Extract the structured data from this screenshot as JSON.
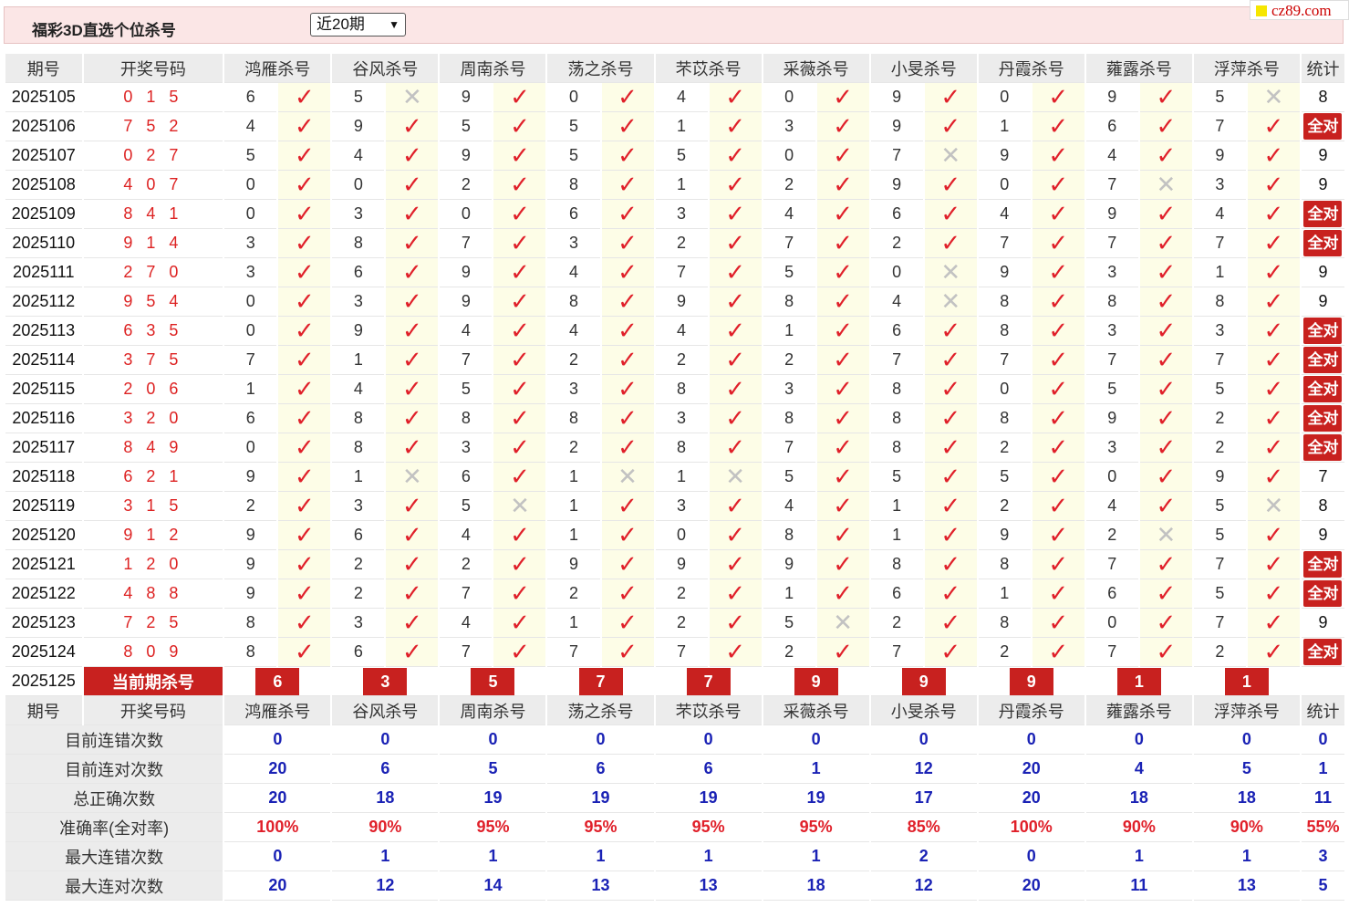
{
  "title": "福彩3D直选个位杀号",
  "period_select": "近20期",
  "brand": "cz89.com",
  "headers": {
    "issue": "期号",
    "draw": "开奖号码",
    "experts": [
      "鸿雁杀号",
      "谷风杀号",
      "周南杀号",
      "荡之杀号",
      "芣苡杀号",
      "采薇杀号",
      "小旻杀号",
      "丹霞杀号",
      "蕹露杀号",
      "浮萍杀号"
    ],
    "stat": "统计"
  },
  "rows": [
    {
      "issue": "2025105",
      "draw": "0 1 5",
      "kills": [
        [
          "6",
          1
        ],
        [
          "5",
          0
        ],
        [
          "9",
          1
        ],
        [
          "0",
          1
        ],
        [
          "4",
          1
        ],
        [
          "0",
          1
        ],
        [
          "9",
          1
        ],
        [
          "0",
          1
        ],
        [
          "9",
          1
        ],
        [
          "5",
          0
        ]
      ],
      "stat": "8"
    },
    {
      "issue": "2025106",
      "draw": "7 5 2",
      "kills": [
        [
          "4",
          1
        ],
        [
          "9",
          1
        ],
        [
          "5",
          1
        ],
        [
          "5",
          1
        ],
        [
          "1",
          1
        ],
        [
          "3",
          1
        ],
        [
          "9",
          1
        ],
        [
          "1",
          1
        ],
        [
          "6",
          1
        ],
        [
          "7",
          1
        ]
      ],
      "stat": "全对"
    },
    {
      "issue": "2025107",
      "draw": "0 2 7",
      "kills": [
        [
          "5",
          1
        ],
        [
          "4",
          1
        ],
        [
          "9",
          1
        ],
        [
          "5",
          1
        ],
        [
          "5",
          1
        ],
        [
          "0",
          1
        ],
        [
          "7",
          0
        ],
        [
          "9",
          1
        ],
        [
          "4",
          1
        ],
        [
          "9",
          1
        ]
      ],
      "stat": "9"
    },
    {
      "issue": "2025108",
      "draw": "4 0 7",
      "kills": [
        [
          "0",
          1
        ],
        [
          "0",
          1
        ],
        [
          "2",
          1
        ],
        [
          "8",
          1
        ],
        [
          "1",
          1
        ],
        [
          "2",
          1
        ],
        [
          "9",
          1
        ],
        [
          "0",
          1
        ],
        [
          "7",
          0
        ],
        [
          "3",
          1
        ]
      ],
      "stat": "9"
    },
    {
      "issue": "2025109",
      "draw": "8 4 1",
      "kills": [
        [
          "0",
          1
        ],
        [
          "3",
          1
        ],
        [
          "0",
          1
        ],
        [
          "6",
          1
        ],
        [
          "3",
          1
        ],
        [
          "4",
          1
        ],
        [
          "6",
          1
        ],
        [
          "4",
          1
        ],
        [
          "9",
          1
        ],
        [
          "4",
          1
        ]
      ],
      "stat": "全对"
    },
    {
      "issue": "2025110",
      "draw": "9 1 4",
      "kills": [
        [
          "3",
          1
        ],
        [
          "8",
          1
        ],
        [
          "7",
          1
        ],
        [
          "3",
          1
        ],
        [
          "2",
          1
        ],
        [
          "7",
          1
        ],
        [
          "2",
          1
        ],
        [
          "7",
          1
        ],
        [
          "7",
          1
        ],
        [
          "7",
          1
        ]
      ],
      "stat": "全对"
    },
    {
      "issue": "2025111",
      "draw": "2 7 0",
      "kills": [
        [
          "3",
          1
        ],
        [
          "6",
          1
        ],
        [
          "9",
          1
        ],
        [
          "4",
          1
        ],
        [
          "7",
          1
        ],
        [
          "5",
          1
        ],
        [
          "0",
          0
        ],
        [
          "9",
          1
        ],
        [
          "3",
          1
        ],
        [
          "1",
          1
        ]
      ],
      "stat": "9"
    },
    {
      "issue": "2025112",
      "draw": "9 5 4",
      "kills": [
        [
          "0",
          1
        ],
        [
          "3",
          1
        ],
        [
          "9",
          1
        ],
        [
          "8",
          1
        ],
        [
          "9",
          1
        ],
        [
          "8",
          1
        ],
        [
          "4",
          0
        ],
        [
          "8",
          1
        ],
        [
          "8",
          1
        ],
        [
          "8",
          1
        ]
      ],
      "stat": "9"
    },
    {
      "issue": "2025113",
      "draw": "6 3 5",
      "kills": [
        [
          "0",
          1
        ],
        [
          "9",
          1
        ],
        [
          "4",
          1
        ],
        [
          "4",
          1
        ],
        [
          "4",
          1
        ],
        [
          "1",
          1
        ],
        [
          "6",
          1
        ],
        [
          "8",
          1
        ],
        [
          "3",
          1
        ],
        [
          "3",
          1
        ]
      ],
      "stat": "全对"
    },
    {
      "issue": "2025114",
      "draw": "3 7 5",
      "kills": [
        [
          "7",
          1
        ],
        [
          "1",
          1
        ],
        [
          "7",
          1
        ],
        [
          "2",
          1
        ],
        [
          "2",
          1
        ],
        [
          "2",
          1
        ],
        [
          "7",
          1
        ],
        [
          "7",
          1
        ],
        [
          "7",
          1
        ],
        [
          "7",
          1
        ]
      ],
      "stat": "全对"
    },
    {
      "issue": "2025115",
      "draw": "2 0 6",
      "kills": [
        [
          "1",
          1
        ],
        [
          "4",
          1
        ],
        [
          "5",
          1
        ],
        [
          "3",
          1
        ],
        [
          "8",
          1
        ],
        [
          "3",
          1
        ],
        [
          "8",
          1
        ],
        [
          "0",
          1
        ],
        [
          "5",
          1
        ],
        [
          "5",
          1
        ]
      ],
      "stat": "全对"
    },
    {
      "issue": "2025116",
      "draw": "3 2 0",
      "kills": [
        [
          "6",
          1
        ],
        [
          "8",
          1
        ],
        [
          "8",
          1
        ],
        [
          "8",
          1
        ],
        [
          "3",
          1
        ],
        [
          "8",
          1
        ],
        [
          "8",
          1
        ],
        [
          "8",
          1
        ],
        [
          "9",
          1
        ],
        [
          "2",
          1
        ]
      ],
      "stat": "全对"
    },
    {
      "issue": "2025117",
      "draw": "8 4 9",
      "kills": [
        [
          "0",
          1
        ],
        [
          "8",
          1
        ],
        [
          "3",
          1
        ],
        [
          "2",
          1
        ],
        [
          "8",
          1
        ],
        [
          "7",
          1
        ],
        [
          "8",
          1
        ],
        [
          "2",
          1
        ],
        [
          "3",
          1
        ],
        [
          "2",
          1
        ]
      ],
      "stat": "全对"
    },
    {
      "issue": "2025118",
      "draw": "6 2 1",
      "kills": [
        [
          "9",
          1
        ],
        [
          "1",
          0
        ],
        [
          "6",
          1
        ],
        [
          "1",
          0
        ],
        [
          "1",
          0
        ],
        [
          "5",
          1
        ],
        [
          "5",
          1
        ],
        [
          "5",
          1
        ],
        [
          "0",
          1
        ],
        [
          "9",
          1
        ]
      ],
      "stat": "7"
    },
    {
      "issue": "2025119",
      "draw": "3 1 5",
      "kills": [
        [
          "2",
          1
        ],
        [
          "3",
          1
        ],
        [
          "5",
          0
        ],
        [
          "1",
          1
        ],
        [
          "3",
          1
        ],
        [
          "4",
          1
        ],
        [
          "1",
          1
        ],
        [
          "2",
          1
        ],
        [
          "4",
          1
        ],
        [
          "5",
          0
        ]
      ],
      "stat": "8"
    },
    {
      "issue": "2025120",
      "draw": "9 1 2",
      "kills": [
        [
          "9",
          1
        ],
        [
          "6",
          1
        ],
        [
          "4",
          1
        ],
        [
          "1",
          1
        ],
        [
          "0",
          1
        ],
        [
          "8",
          1
        ],
        [
          "1",
          1
        ],
        [
          "9",
          1
        ],
        [
          "2",
          0
        ],
        [
          "5",
          1
        ]
      ],
      "stat": "9"
    },
    {
      "issue": "2025121",
      "draw": "1 2 0",
      "kills": [
        [
          "9",
          1
        ],
        [
          "2",
          1
        ],
        [
          "2",
          1
        ],
        [
          "9",
          1
        ],
        [
          "9",
          1
        ],
        [
          "9",
          1
        ],
        [
          "8",
          1
        ],
        [
          "8",
          1
        ],
        [
          "7",
          1
        ],
        [
          "7",
          1
        ]
      ],
      "stat": "全对"
    },
    {
      "issue": "2025122",
      "draw": "4 8 8",
      "kills": [
        [
          "9",
          1
        ],
        [
          "2",
          1
        ],
        [
          "7",
          1
        ],
        [
          "2",
          1
        ],
        [
          "2",
          1
        ],
        [
          "1",
          1
        ],
        [
          "6",
          1
        ],
        [
          "1",
          1
        ],
        [
          "6",
          1
        ],
        [
          "5",
          1
        ]
      ],
      "stat": "全对"
    },
    {
      "issue": "2025123",
      "draw": "7 2 5",
      "kills": [
        [
          "8",
          1
        ],
        [
          "3",
          1
        ],
        [
          "4",
          1
        ],
        [
          "1",
          1
        ],
        [
          "2",
          1
        ],
        [
          "5",
          0
        ],
        [
          "2",
          1
        ],
        [
          "8",
          1
        ],
        [
          "0",
          1
        ],
        [
          "7",
          1
        ]
      ],
      "stat": "9"
    },
    {
      "issue": "2025124",
      "draw": "8 0 9",
      "kills": [
        [
          "8",
          1
        ],
        [
          "6",
          1
        ],
        [
          "7",
          1
        ],
        [
          "7",
          1
        ],
        [
          "7",
          1
        ],
        [
          "2",
          1
        ],
        [
          "7",
          1
        ],
        [
          "2",
          1
        ],
        [
          "7",
          1
        ],
        [
          "2",
          1
        ]
      ],
      "stat": "全对"
    }
  ],
  "current": {
    "issue": "2025125",
    "label": "当前期杀号",
    "kills": [
      "6",
      "3",
      "5",
      "7",
      "7",
      "9",
      "9",
      "9",
      "1",
      "1"
    ]
  },
  "summary": [
    {
      "label": "目前连错次数",
      "values": [
        "0",
        "0",
        "0",
        "0",
        "0",
        "0",
        "0",
        "0",
        "0",
        "0",
        "0"
      ],
      "kind": "num"
    },
    {
      "label": "目前连对次数",
      "values": [
        "20",
        "6",
        "5",
        "6",
        "6",
        "1",
        "12",
        "20",
        "4",
        "5",
        "1"
      ],
      "kind": "num"
    },
    {
      "label": "总正确次数",
      "values": [
        "20",
        "18",
        "19",
        "19",
        "19",
        "19",
        "17",
        "20",
        "18",
        "18",
        "11"
      ],
      "kind": "num"
    },
    {
      "label": "准确率(全对率)",
      "values": [
        "100%",
        "90%",
        "95%",
        "95%",
        "95%",
        "95%",
        "85%",
        "100%",
        "90%",
        "90%",
        "55%"
      ],
      "kind": "rate"
    },
    {
      "label": "最大连错次数",
      "values": [
        "0",
        "1",
        "1",
        "1",
        "1",
        "1",
        "2",
        "0",
        "1",
        "1",
        "3"
      ],
      "kind": "num"
    },
    {
      "label": "最大连对次数",
      "values": [
        "20",
        "12",
        "14",
        "13",
        "13",
        "18",
        "12",
        "20",
        "11",
        "13",
        "5"
      ],
      "kind": "num"
    }
  ],
  "icons": {
    "hit": "check-icon",
    "miss": "cross-icon"
  },
  "colors": {
    "hit": "#e0202a",
    "miss": "#c2c2c2",
    "accent": "#c8211f",
    "summary": "#1a22b5"
  }
}
